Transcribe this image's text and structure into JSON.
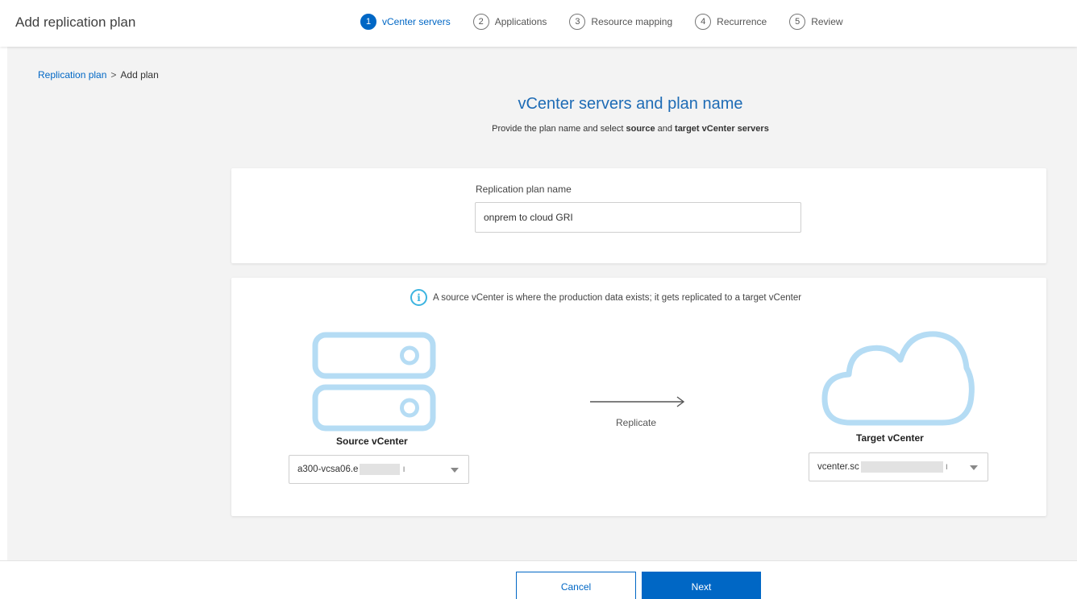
{
  "header": {
    "title": "Add replication plan",
    "steps": [
      {
        "number": "1",
        "label": "vCenter servers",
        "active": true
      },
      {
        "number": "2",
        "label": "Applications",
        "active": false
      },
      {
        "number": "3",
        "label": "Resource mapping",
        "active": false
      },
      {
        "number": "4",
        "label": "Recurrence",
        "active": false
      },
      {
        "number": "5",
        "label": "Review",
        "active": false
      }
    ]
  },
  "breadcrumb": {
    "parent": "Replication plan",
    "separator": ">",
    "current": "Add plan"
  },
  "page": {
    "title": "vCenter servers and plan name",
    "subtitle_parts": [
      "Provide the plan name and select ",
      "source",
      " and ",
      "target vCenter servers"
    ]
  },
  "plan_name": {
    "label": "Replication plan name",
    "value": "onprem to cloud GRI"
  },
  "vcenter": {
    "info_icon": "info-icon",
    "info_text": "A source vCenter is where the production data exists; it gets replicated to a target vCenter",
    "replicate_label": "Replicate",
    "source": {
      "icon": "server-icon",
      "label": "Source vCenter",
      "selected_value": "a300-vcsa06.e",
      "trailing": "ı"
    },
    "target": {
      "icon": "cloud-icon",
      "label": "Target vCenter",
      "selected_value": "vcenter.sc",
      "trailing": "ı"
    }
  },
  "footer": {
    "cancel_label": "Cancel",
    "next_label": "Next"
  },
  "colors": {
    "accent": "#0067c5",
    "icon_light_blue": "#b5dcf4",
    "info_blue": "#3cb4e0",
    "background": "#f3f3f3"
  }
}
